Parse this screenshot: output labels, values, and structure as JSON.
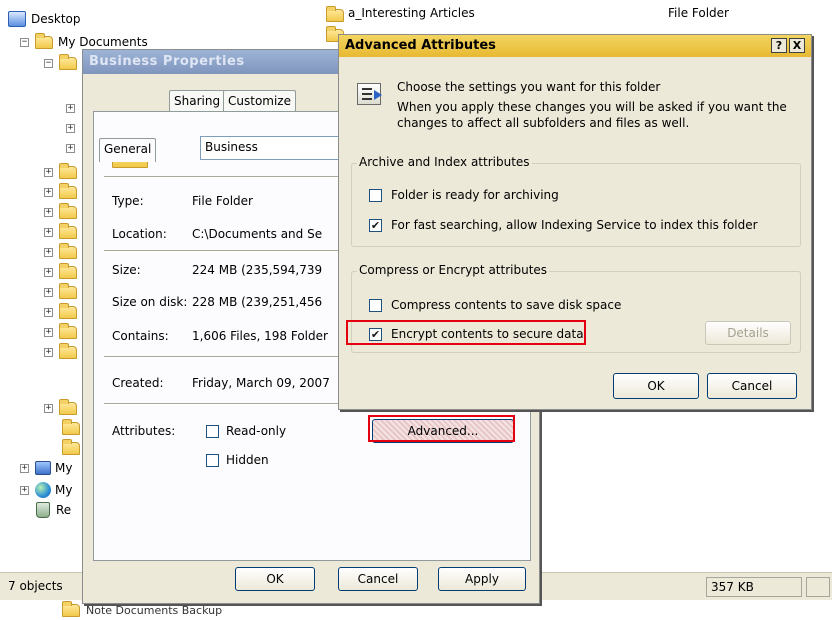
{
  "tree": {
    "desktop": "Desktop",
    "my_documents": "My Documents",
    "my_computer_partial": "My",
    "my_network_partial": "My",
    "recycle_partial": "Re",
    "bottom_folder_partial": "Note Documents Backup"
  },
  "filelist": {
    "row1_name": "a_Interesting Articles",
    "row1_type": "File Folder"
  },
  "statusbar": {
    "objects": "7 objects",
    "size": "357 KB"
  },
  "properties": {
    "title": "Business Properties",
    "tabs": [
      "General",
      "Sharing",
      "Customize"
    ],
    "folder_name": "Business",
    "type_label": "Type:",
    "type_value": "File Folder",
    "location_label": "Location:",
    "location_value": "C:\\Documents and Se",
    "size_label": "Size:",
    "size_value": "224 MB (235,594,739",
    "size_on_disk_label": "Size on disk:",
    "size_on_disk_value": "228 MB (239,251,456",
    "contains_label": "Contains:",
    "contains_value": "1,606 Files, 198 Folder",
    "created_label": "Created:",
    "created_value": "Friday, March 09, 2007",
    "attributes_label": "Attributes:",
    "readonly_label": "Read-only",
    "hidden_label": "Hidden",
    "advanced_button": "Advanced...",
    "ok_button": "OK",
    "cancel_button": "Cancel",
    "apply_button": "Apply"
  },
  "advanced": {
    "title": "Advanced Attributes",
    "intro1": "Choose the settings you want for this folder",
    "intro2": "When you apply these changes you will be asked if you want the changes to affect all subfolders and files as well.",
    "group1_title": "Archive and Index attributes",
    "archive_label": "Folder is ready for archiving",
    "archive_checked": false,
    "index_label": "For fast searching, allow Indexing Service to index this folder",
    "index_checked": true,
    "group2_title": "Compress or Encrypt attributes",
    "compress_label": "Compress contents to save disk space",
    "compress_checked": false,
    "encrypt_label": "Encrypt contents to secure data",
    "encrypt_checked": true,
    "details_button": "Details",
    "ok_button": "OK",
    "cancel_button": "Cancel",
    "help_glyph": "?",
    "close_glyph": "X"
  },
  "colors": {
    "highlight": "#e4000f",
    "dialog_bg": "#ece9d8",
    "active_title": "#e8b932",
    "inactive_title": "#7f95bd"
  }
}
